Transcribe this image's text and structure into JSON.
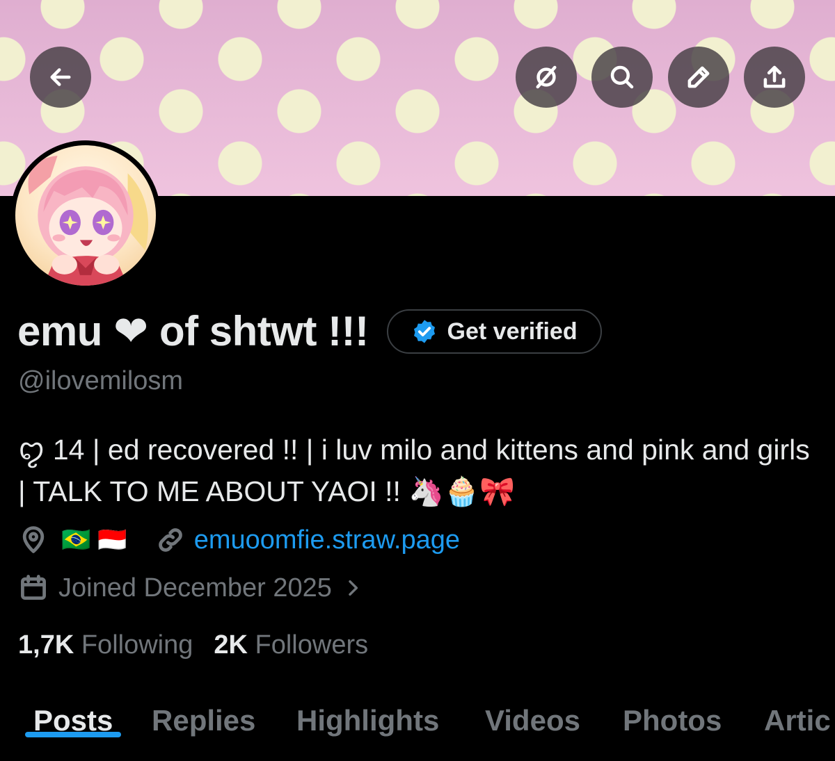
{
  "header": {
    "banner_colors": {
      "background": "#e6b6d2",
      "dots": "#f2f0d0"
    },
    "buttons": {
      "back_icon": "arrow-left-icon",
      "grok_icon": "grok-icon",
      "search_icon": "search-icon",
      "edit_icon": "pencil-icon",
      "share_icon": "share-icon"
    }
  },
  "profile": {
    "display_name": "emu ❤ of shtwt !!!",
    "verify_label": "Get verified",
    "handle": "@ilovemilosm",
    "bio": "ꨄ 14 | ed recovered !! | i luv milo and kittens and pink and girls | TALK TO ME ABOUT YAOI !! 🦄🧁🎀",
    "location_flags": [
      "🇧🇷",
      "🇮🇩"
    ],
    "link": "emuoomfie.straw.page",
    "joined": "Joined December 2025",
    "following_count": "1,7K",
    "following_label": "Following",
    "followers_count": "2K",
    "followers_label": "Followers"
  },
  "tabs": [
    {
      "label": "Posts",
      "active": true
    },
    {
      "label": "Replies",
      "active": false
    },
    {
      "label": "Highlights",
      "active": false
    },
    {
      "label": "Videos",
      "active": false
    },
    {
      "label": "Photos",
      "active": false
    },
    {
      "label": "Artic",
      "active": false
    }
  ],
  "colors": {
    "accent": "#1d9bf0",
    "muted": "#71767b",
    "text": "#e7e9ea",
    "background": "#000000"
  }
}
